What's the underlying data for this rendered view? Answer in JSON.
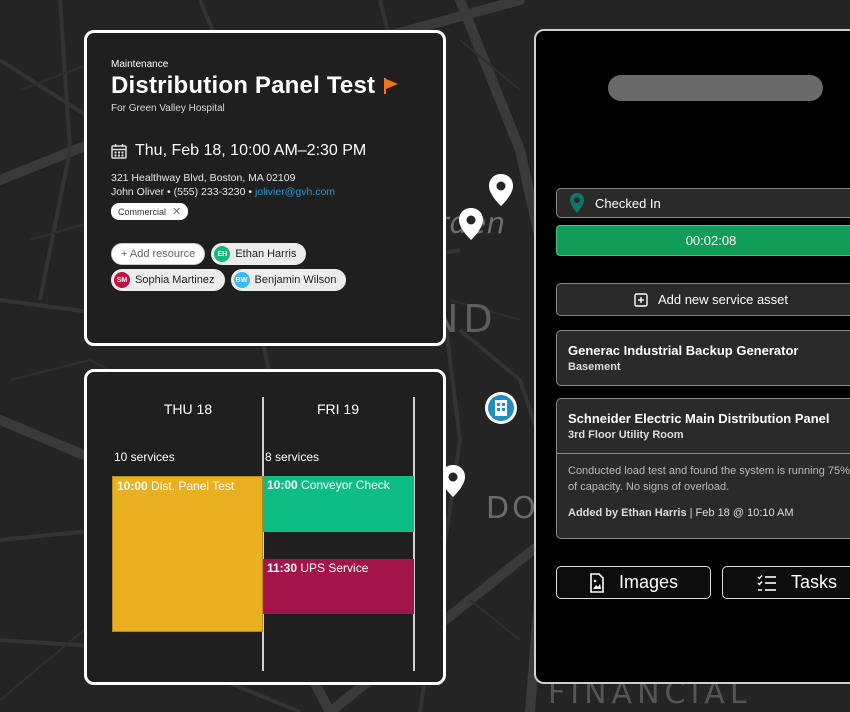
{
  "map": {
    "labels": {
      "td_garden": "TD Garden",
      "west_end": "WEST END",
      "downtown": "DO",
      "financial": "FINANCIAL"
    }
  },
  "job": {
    "category": "Maintenance",
    "title": "Distribution Panel Test",
    "client": "For Green Valley Hospital",
    "datetime": "Thu, Feb 18, 10:00 AM–2:30 PM",
    "address": "321 Healthway Blvd, Boston, MA 02109",
    "contact_name_phone": "John Oliver • (555) 233-3230 •",
    "contact_email": "jolivier@gvh.com",
    "tag": "Commercial",
    "add_resource_label": "+ Add resource",
    "resources": [
      {
        "initials": "EH",
        "name": "Ethan Harris",
        "color": "#10b981"
      },
      {
        "initials": "SM",
        "name": "Sophia Martinez",
        "color": "#be123c"
      },
      {
        "initials": "BW",
        "name": "Benjamin Wilson",
        "color": "#38bdf8"
      }
    ],
    "flag_color": "#f97316"
  },
  "calendar": {
    "days": [
      {
        "header": "THU 18",
        "count": "10 services",
        "events": [
          {
            "time": "10:00",
            "label": "Dist. Panel Test",
            "color": "#e9b021"
          }
        ]
      },
      {
        "header": "FRI 19",
        "count": "8 services",
        "events": [
          {
            "time": "10:00",
            "label": "Conveyor Check",
            "color": "#0dbd84"
          },
          {
            "time": "11:30",
            "label": "UPS Service",
            "color": "#a3154a"
          }
        ]
      }
    ]
  },
  "panel": {
    "status": "Checked In",
    "status_color": "#0f766e",
    "timer": "00:02:08",
    "timer_color": "#0f9d58",
    "add_asset_label": "Add new service asset",
    "assets": [
      {
        "name": "Generac Industrial Backup Generator",
        "location": "Basement"
      },
      {
        "name": "Schneider Electric Main Distribution Panel",
        "location": "3rd Floor Utility Room",
        "note": "Conducted load test and found the system is running 75% of capacity. No signs of overload.",
        "added_by": "Added by Ethan Harris",
        "added_meta": "| Feb 18 @ 10:10 AM"
      }
    ],
    "images_label": "Images",
    "tasks_label": "Tasks"
  }
}
